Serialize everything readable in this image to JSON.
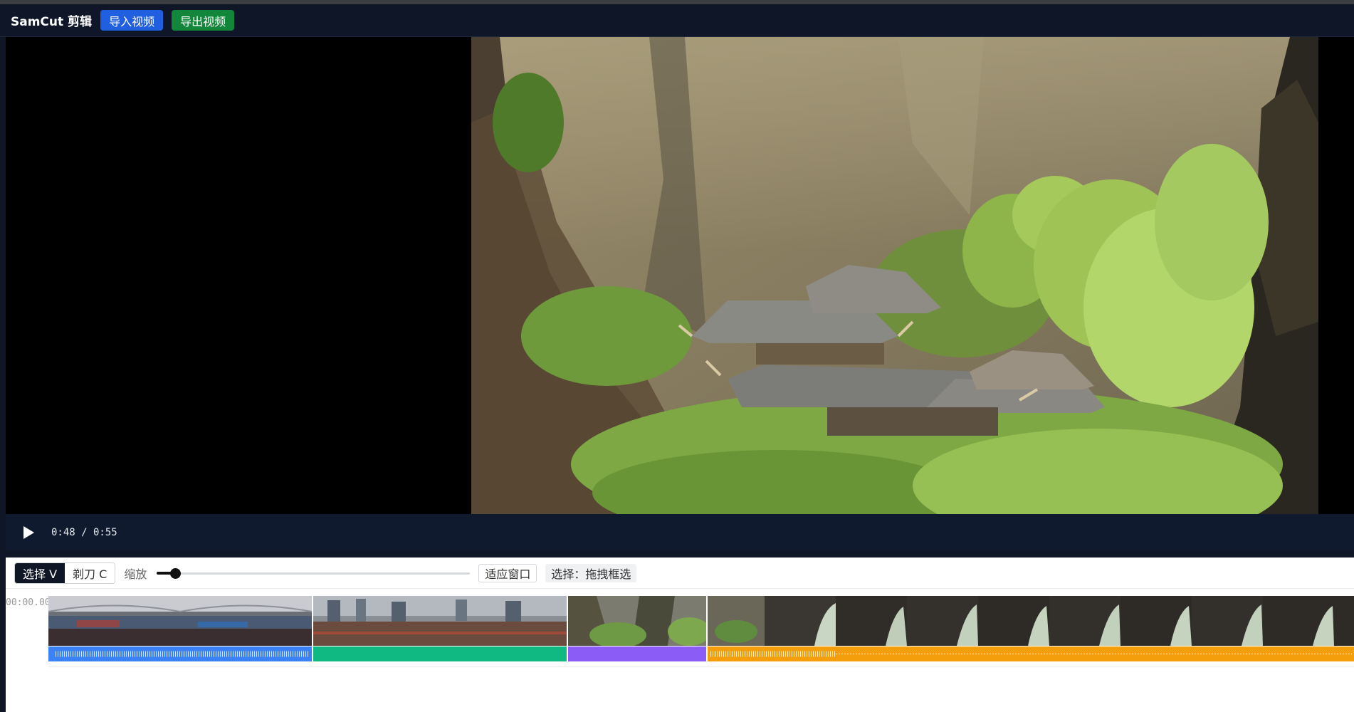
{
  "app": {
    "title": "SamCut 剪辑"
  },
  "header": {
    "import_label": "导入视频",
    "export_label": "导出视频"
  },
  "player": {
    "time": "0:48 / 0:55"
  },
  "timeline": {
    "tools": [
      {
        "label": "选择 V",
        "active": true
      },
      {
        "label": "剃刀 C",
        "active": false
      }
    ],
    "zoom_label": "缩放",
    "zoom_level": 0.06,
    "fit_label": "适应窗口",
    "mode_text": "选择：拖拽框选",
    "ruler_start": "00:00.00",
    "clips": [
      {
        "color": "#3b82f6",
        "has_audio": true
      },
      {
        "color": "#10b981",
        "has_audio": false
      },
      {
        "color": "#8b5cf6",
        "has_audio": false
      },
      {
        "color": "#f59e0b",
        "has_audio": true
      }
    ]
  }
}
